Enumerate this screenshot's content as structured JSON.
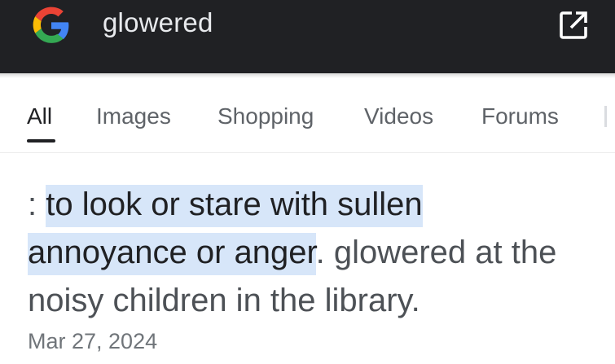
{
  "header": {
    "query": "glowered",
    "logo_icon": "google-g-icon",
    "open_icon": "open-in-new-icon",
    "background": "#202124"
  },
  "tabs": [
    {
      "label": "All",
      "active": true
    },
    {
      "label": "Images",
      "active": false
    },
    {
      "label": "Shopping",
      "active": false
    },
    {
      "label": "Videos",
      "active": false
    },
    {
      "label": "Forums",
      "active": false
    }
  ],
  "result": {
    "prefix": ": ",
    "highlight_line1": "to look or stare with sullen",
    "highlight_line2": "annoyance or anger",
    "rest": ". glowered at the noisy children in the library.",
    "date": "Mar 27, 2024",
    "highlight_color": "#d7e6f9"
  }
}
